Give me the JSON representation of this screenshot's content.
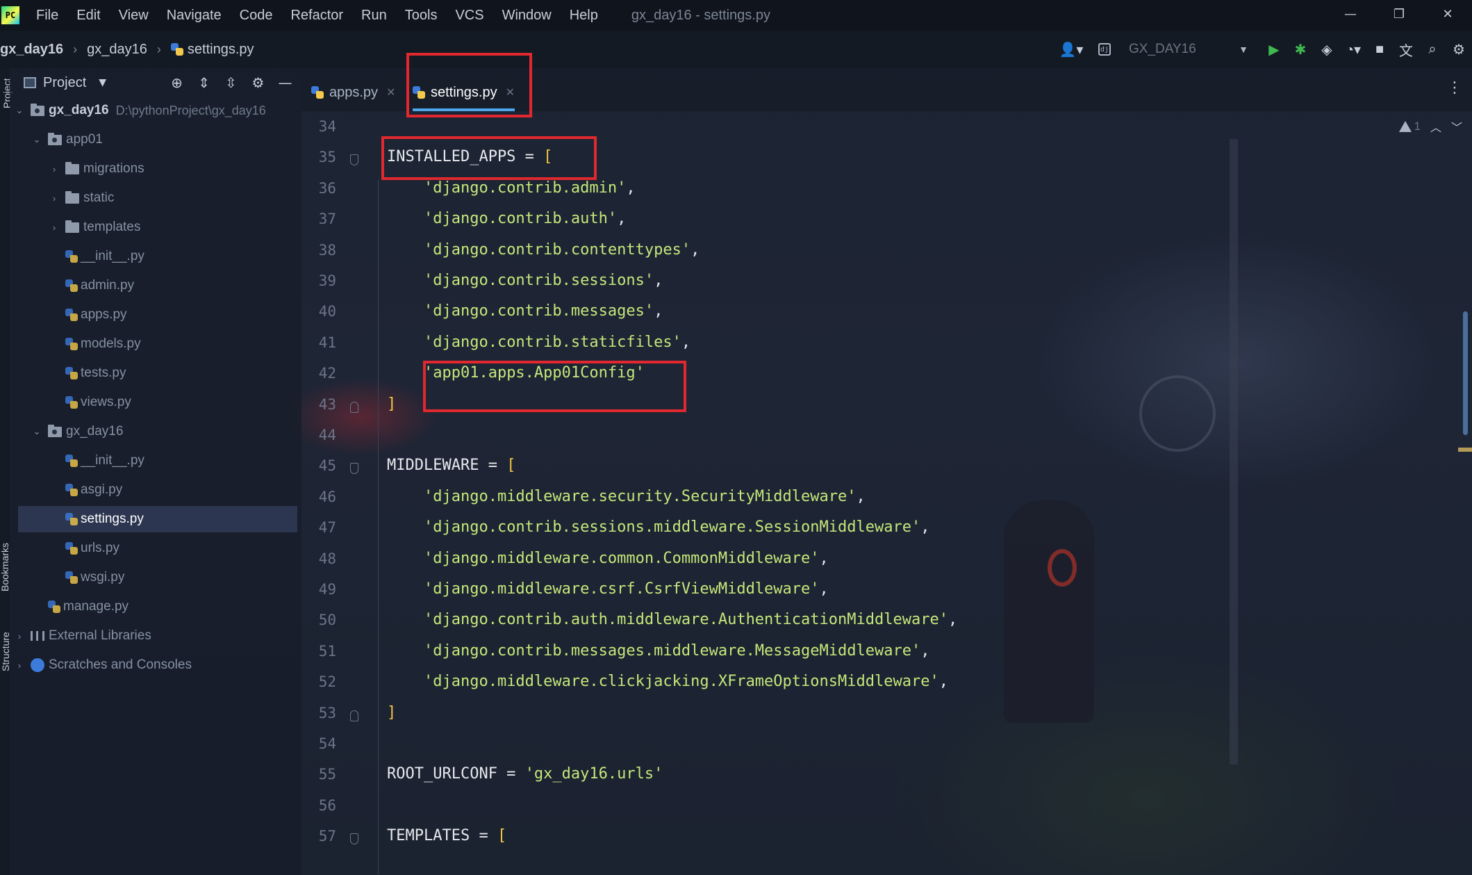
{
  "menubar": {
    "logo_text": "PC",
    "items": [
      "File",
      "Edit",
      "View",
      "Navigate",
      "Code",
      "Refactor",
      "Run",
      "Tools",
      "VCS",
      "Window",
      "Help"
    ],
    "window_title": "gx_day16 - settings.py",
    "controls": {
      "minimize": "—",
      "restore": "❐",
      "close": "✕"
    }
  },
  "navbar": {
    "breadcrumb": [
      "gx_day16",
      "gx_day16",
      "settings.py"
    ],
    "run_config": "GX_DAY16",
    "run_config_icon": "dj"
  },
  "side_strip": {
    "top": "Project",
    "middle": "Bookmarks",
    "bottom": "Structure"
  },
  "project_panel": {
    "title": "Project",
    "tree": [
      {
        "label": "gx_day16",
        "path": "D:\\pythonProject\\gx_day16",
        "type": "module-folder",
        "depth": 0,
        "arrow": "open"
      },
      {
        "label": "app01",
        "type": "folder",
        "depth": 1,
        "arrow": "open"
      },
      {
        "label": "migrations",
        "type": "folder",
        "depth": 2,
        "arrow": "closed"
      },
      {
        "label": "static",
        "type": "folder",
        "depth": 2,
        "arrow": "closed"
      },
      {
        "label": "templates",
        "type": "folder",
        "depth": 2,
        "arrow": "closed"
      },
      {
        "label": "__init__.py",
        "type": "py",
        "depth": 2
      },
      {
        "label": "admin.py",
        "type": "py",
        "depth": 2
      },
      {
        "label": "apps.py",
        "type": "py",
        "depth": 2
      },
      {
        "label": "models.py",
        "type": "py",
        "depth": 2
      },
      {
        "label": "tests.py",
        "type": "py",
        "depth": 2
      },
      {
        "label": "views.py",
        "type": "py",
        "depth": 2
      },
      {
        "label": "gx_day16",
        "type": "folder",
        "depth": 1,
        "arrow": "open"
      },
      {
        "label": "__init__.py",
        "type": "py",
        "depth": 2
      },
      {
        "label": "asgi.py",
        "type": "py",
        "depth": 2
      },
      {
        "label": "settings.py",
        "type": "py",
        "depth": 2,
        "selected": true
      },
      {
        "label": "urls.py",
        "type": "py",
        "depth": 2
      },
      {
        "label": "wsgi.py",
        "type": "py",
        "depth": 2
      },
      {
        "label": "manage.py",
        "type": "py",
        "depth": 1
      },
      {
        "label": "External Libraries",
        "type": "libs",
        "depth": 0,
        "arrow": "closed"
      },
      {
        "label": "Scratches and Consoles",
        "type": "scratch",
        "depth": 0,
        "arrow": "closed"
      }
    ]
  },
  "editor": {
    "tabs": [
      {
        "label": "apps.py",
        "active": false
      },
      {
        "label": "settings.py",
        "active": true
      }
    ],
    "inspection_count": "1",
    "first_line": 34,
    "lines": [
      "",
      "INSTALLED_APPS = [",
      "    'django.contrib.admin',",
      "    'django.contrib.auth',",
      "    'django.contrib.contenttypes',",
      "    'django.contrib.sessions',",
      "    'django.contrib.messages',",
      "    'django.contrib.staticfiles',",
      "    'app01.apps.App01Config'",
      "]",
      "",
      "MIDDLEWARE = [",
      "    'django.middleware.security.SecurityMiddleware',",
      "    'django.contrib.sessions.middleware.SessionMiddleware',",
      "    'django.middleware.common.CommonMiddleware',",
      "    'django.middleware.csrf.CsrfViewMiddleware',",
      "    'django.contrib.auth.middleware.AuthenticationMiddleware',",
      "    'django.contrib.messages.middleware.MessageMiddleware',",
      "    'django.middleware.clickjacking.XFrameOptionsMiddleware',",
      "]",
      "",
      "ROOT_URLCONF = 'gx_day16.urls'",
      "",
      "TEMPLATES = ["
    ]
  },
  "colors": {
    "highlight_box": "#e0282e",
    "string": "#c4e87a",
    "bracket": "#f5c542",
    "selection": "#2d3650",
    "tab_underline": "#4ca6e8"
  }
}
